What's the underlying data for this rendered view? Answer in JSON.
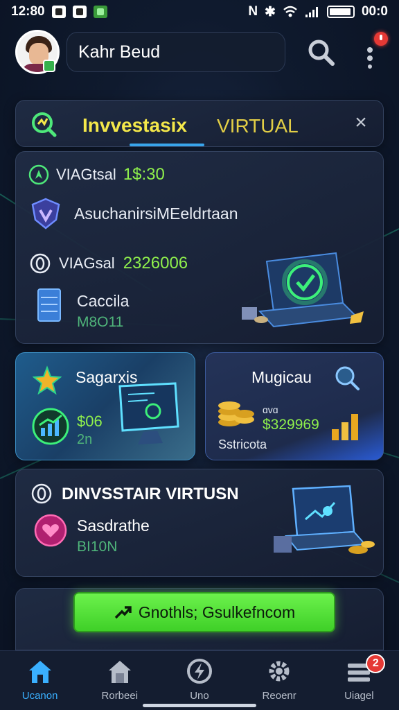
{
  "status_bar": {
    "time": "12:80",
    "right_time": "00:0"
  },
  "header": {
    "user_name": "Kahr Beud"
  },
  "tabs": {
    "active_label": "Invvestasix",
    "second_label": "VIRTUAL",
    "close_glyph": "×"
  },
  "main_card": {
    "line1_label": "VIAGtsal",
    "line1_value": "1$:30",
    "line2_label": "AsuchanirsiMEeldrtaan",
    "line3_label": "VIAGsal",
    "line3_value": "2326006",
    "line4_label": "Caccila",
    "line4_sub": "M8O11"
  },
  "card_left": {
    "title": "Sagarxis",
    "value": "$06",
    "sub": "2n"
  },
  "card_right": {
    "title": "Mugicau",
    "value_small": "ɑvɑ",
    "value": "$329969",
    "sub": "Sstricota"
  },
  "invest_card": {
    "title": "DINVSSTAIR VIRTUSN",
    "label": "Sasdrathe",
    "sub": "BI10N"
  },
  "cta": {
    "label": "Gnothls; Gsulkefncom"
  },
  "bottom_nav": [
    {
      "label": "Ucanon",
      "icon": "home-icon",
      "active": true
    },
    {
      "label": "Rorbeei",
      "icon": "house-icon",
      "active": false
    },
    {
      "label": "Uno",
      "icon": "lightning-icon",
      "active": false
    },
    {
      "label": "Reoenr",
      "icon": "gear-icon",
      "active": false
    },
    {
      "label": "Uiagel",
      "icon": "list-icon",
      "active": false,
      "badge": "2"
    }
  ],
  "colors": {
    "accent_green": "#6cf24c",
    "accent_yellow": "#f4e84a",
    "accent_blue": "#3ab0ff",
    "badge_red": "#e53935"
  }
}
